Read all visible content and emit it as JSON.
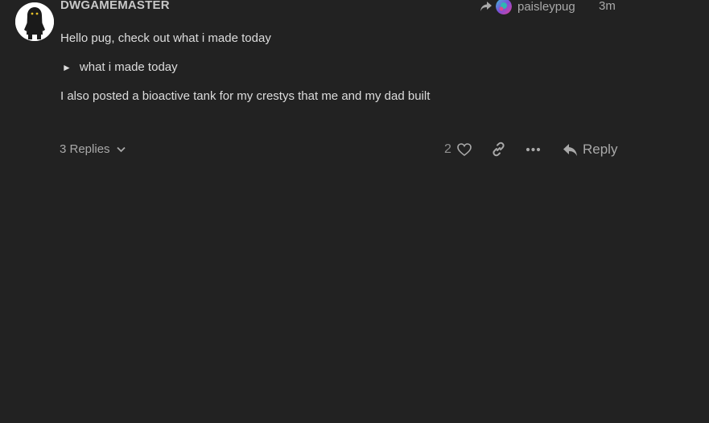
{
  "post": {
    "username": "DWGAMEMASTER",
    "reply_to_name": "paisleypug",
    "date": "3m",
    "body_line1": "Hello pug, check out what i made today",
    "details_marker": "►",
    "details_summary": "what i made today",
    "body_line3": "I also posted a bioactive tank for my crestys that me and my dad built"
  },
  "actions": {
    "replies_label": "3 Replies",
    "like_count": "2",
    "reply_label": "Reply"
  },
  "icons": {
    "share": "share-arrow-icon",
    "chevron": "chevron-down-icon",
    "like": "heart-icon",
    "link": "link-icon",
    "more": "ellipsis-icon",
    "reply": "reply-arrow-icon"
  },
  "colors": {
    "background": "#222222",
    "text": "#dddddd",
    "muted": "#a9a9a9"
  }
}
